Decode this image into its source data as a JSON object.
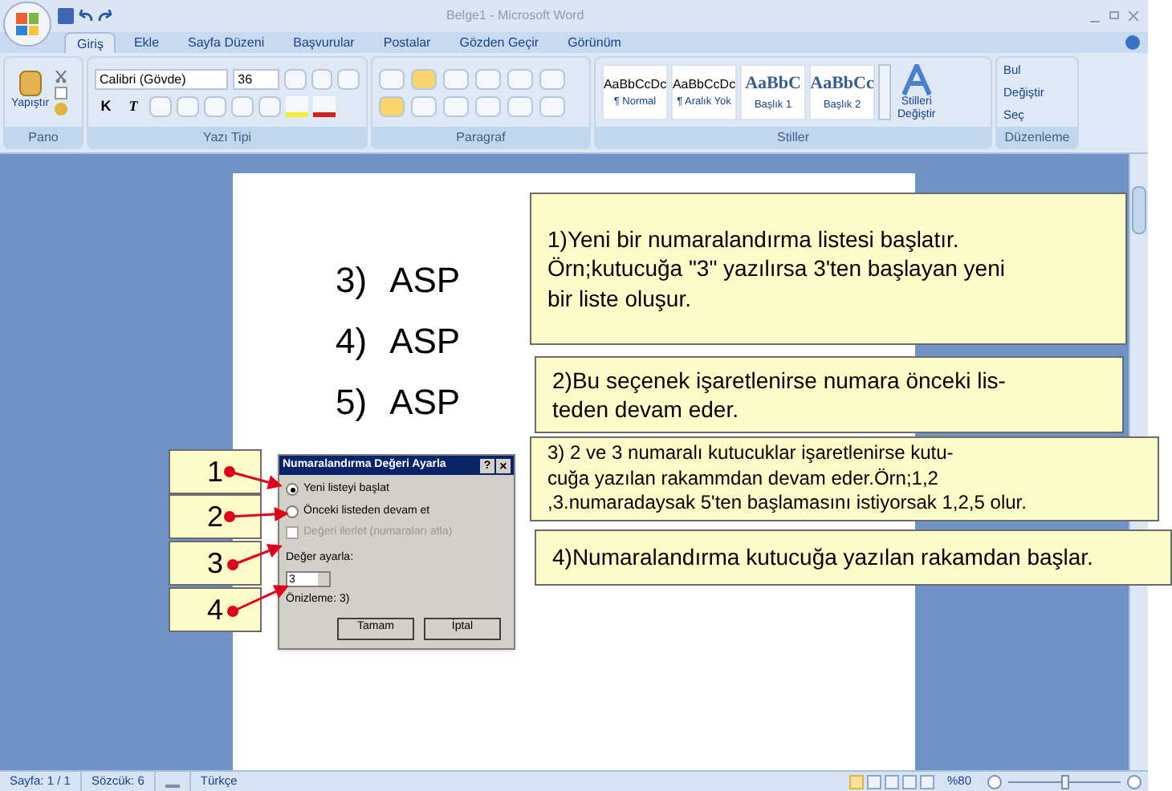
{
  "window": {
    "title": "Belge1 - Microsoft Word"
  },
  "tabs": [
    {
      "label": "Giriş",
      "selected": true
    },
    {
      "label": "Ekle",
      "selected": false
    },
    {
      "label": "Sayfa Düzeni",
      "selected": false
    },
    {
      "label": "Başvurular",
      "selected": false
    },
    {
      "label": "Postalar",
      "selected": false
    },
    {
      "label": "Gözden Geçir",
      "selected": false
    },
    {
      "label": "Görünüm",
      "selected": false
    }
  ],
  "ribbon": {
    "clipboard": {
      "label": "Pano",
      "paste": "Yapıştır"
    },
    "font": {
      "label": "Yazı Tipi",
      "name": "Calibri (Gövde)",
      "size": "36",
      "bold": "K",
      "italic": "T"
    },
    "paragraph": {
      "label": "Paragraf"
    },
    "styles": {
      "label": "Stiller",
      "items": [
        {
          "preview": "AaBbCcDc",
          "name": "¶ Normal",
          "kind": "plain"
        },
        {
          "preview": "AaBbCcDc",
          "name": "¶ Aralık Yok",
          "kind": "plain"
        },
        {
          "preview": "AaBbC",
          "name": "Başlık 1",
          "kind": "heading"
        },
        {
          "preview": "AaBbCc",
          "name": "Başlık 2",
          "kind": "heading"
        }
      ],
      "change_line1": "Stilleri",
      "change_line2": "Değiştir"
    },
    "editing": {
      "label": "Düzenleme",
      "items": [
        "Bul",
        "Değiştir",
        "Seç"
      ]
    }
  },
  "document": {
    "list": [
      {
        "number": "3)",
        "text": "ASP"
      },
      {
        "number": "4)",
        "text": "ASP"
      },
      {
        "number": "5)",
        "text": "ASP"
      }
    ]
  },
  "dialog": {
    "title": "Numaralandırma Değeri Ayarla",
    "help": "?",
    "close": "×",
    "options": [
      {
        "kind": "radio",
        "label": "Yeni listeyi başlat",
        "selected": true,
        "disabled": false
      },
      {
        "kind": "radio",
        "label": "Önceki listeden devam et",
        "selected": false,
        "disabled": false
      },
      {
        "kind": "checkbox",
        "label": "Değeri ilerlet (numaraları atla)",
        "checked": false,
        "disabled": true
      }
    ],
    "value_label": "Değer ayarla:",
    "value": "3",
    "preview": "Önizleme: 3)",
    "buttons": [
      "Tamam",
      "İptal"
    ]
  },
  "markers": [
    "1",
    "2",
    "3",
    "4"
  ],
  "callouts": [
    {
      "lines": [
        "1)Yeni bir numaralandırma listesi başlatır.",
        "Örn;kutucuğa \"3\" yazılırsa 3'ten başlayan yeni",
        "bir liste oluşur."
      ]
    },
    {
      "lines": [
        "2)Bu seçenek işaretlenirse numara önceki lis-",
        "teden devam eder."
      ]
    },
    {
      "lines": [
        "3) 2 ve 3 numaralı kutucuklar işaretlenirse kutu-",
        "cuğa yazılan rakammdan devam eder.Örn;1,2",
        ",3.numaradaysak 5'ten başlamasını istiyorsak 1,2,5 olur."
      ]
    },
    {
      "lines": [
        "4)Numaralandırma kutucuğa yazılan rakamdan başlar."
      ]
    }
  ],
  "status_bar": {
    "page": "Sayfa: 1 / 1",
    "words": "Sözcük: 6",
    "language": "Türkçe",
    "zoom": "%80",
    "zoom_slider": {
      "level": 0.5
    }
  }
}
